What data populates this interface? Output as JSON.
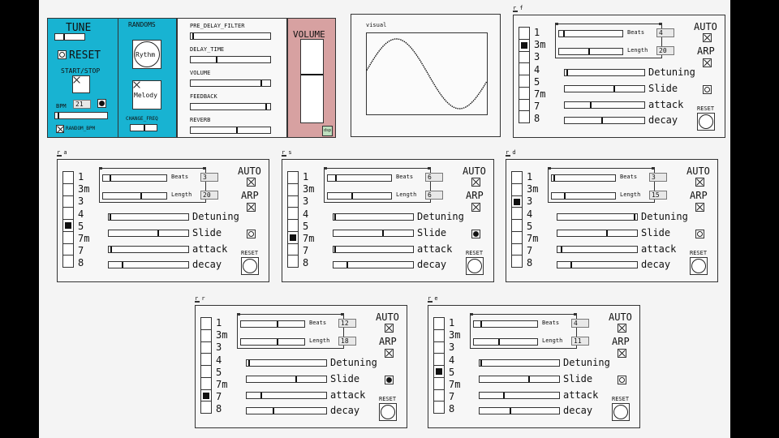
{
  "main": {
    "tune_label": "TUNE",
    "reset_label": "RESET",
    "start_stop_label": "START/STOP",
    "bpm_label": "BPM",
    "bpm_value": "21",
    "random_bpm_label": "RANDOM_BPM",
    "randoms_label": "RANDOMS",
    "rythm_label": "Rythm",
    "melody_label": "Melody",
    "change_freq_label": "CHANGE_FREQ",
    "volume_label": "VOLUME",
    "dsp_label": "dsp",
    "fx": [
      {
        "label": "PRE_DELAY_FILTER",
        "value": 0.02
      },
      {
        "label": "DELAY_TIME",
        "value": 0.32
      },
      {
        "label": "VOLUME",
        "value": 0.9
      },
      {
        "label": "FEEDBACK",
        "value": 0.96
      },
      {
        "label": "REVERB",
        "value": 0.58
      }
    ]
  },
  "visual": {
    "label": "visual"
  },
  "module_labels": {
    "steps": [
      "1",
      "3m",
      "3",
      "4",
      "5",
      "7m",
      "7",
      "8"
    ],
    "beats": "Beats",
    "length": "Length",
    "auto": "AUTO",
    "arp": "ARP",
    "detuning": "Detuning",
    "slide": "Slide",
    "attack": "attack",
    "decay": "decay",
    "reset": "RESET"
  },
  "modules": [
    {
      "tag": "r f",
      "beats": "4",
      "length": "20",
      "selected_step": 1,
      "beats_val": 0.06,
      "length_val": 0.48,
      "detune": 0.02,
      "slide_on": false,
      "attack": 0.32,
      "decay": 0.47,
      "auto": true,
      "arp": true
    },
    {
      "tag": "r a",
      "beats": "3",
      "length": "20",
      "selected_step": 4,
      "beats_val": 0.1,
      "length_val": 0.6,
      "detune": 0.01,
      "slide_on": false,
      "attack": 0.02,
      "decay": 0.17,
      "auto": true,
      "arp": true
    },
    {
      "tag": "r s",
      "beats": "6",
      "length": "6",
      "selected_step": 5,
      "beats_val": 0.12,
      "length_val": 0.38,
      "detune": 0.01,
      "slide_on": true,
      "attack": 0.01,
      "decay": 0.17,
      "auto": true,
      "arp": true
    },
    {
      "tag": "r d",
      "beats": "3",
      "length": "15",
      "selected_step": 2,
      "beats_val": 0.02,
      "length_val": 0.2,
      "detune": 0.98,
      "slide_on": false,
      "attack": 0.04,
      "decay": 0.17,
      "auto": true,
      "arp": true
    },
    {
      "tag": "r r",
      "beats": "12",
      "length": "18",
      "selected_step": 6,
      "beats_val": 0.58,
      "length_val": 0.58,
      "detune": 0.02,
      "slide_on": true,
      "attack": 0.18,
      "decay": 0.33,
      "auto": true,
      "arp": true
    },
    {
      "tag": "r e",
      "beats": "4",
      "length": "11",
      "selected_step": 4,
      "beats_val": 0.1,
      "length_val": 0.4,
      "detune": 0.01,
      "slide_on": false,
      "attack": 0.3,
      "decay": 0.39,
      "auto": true,
      "arp": true
    }
  ]
}
